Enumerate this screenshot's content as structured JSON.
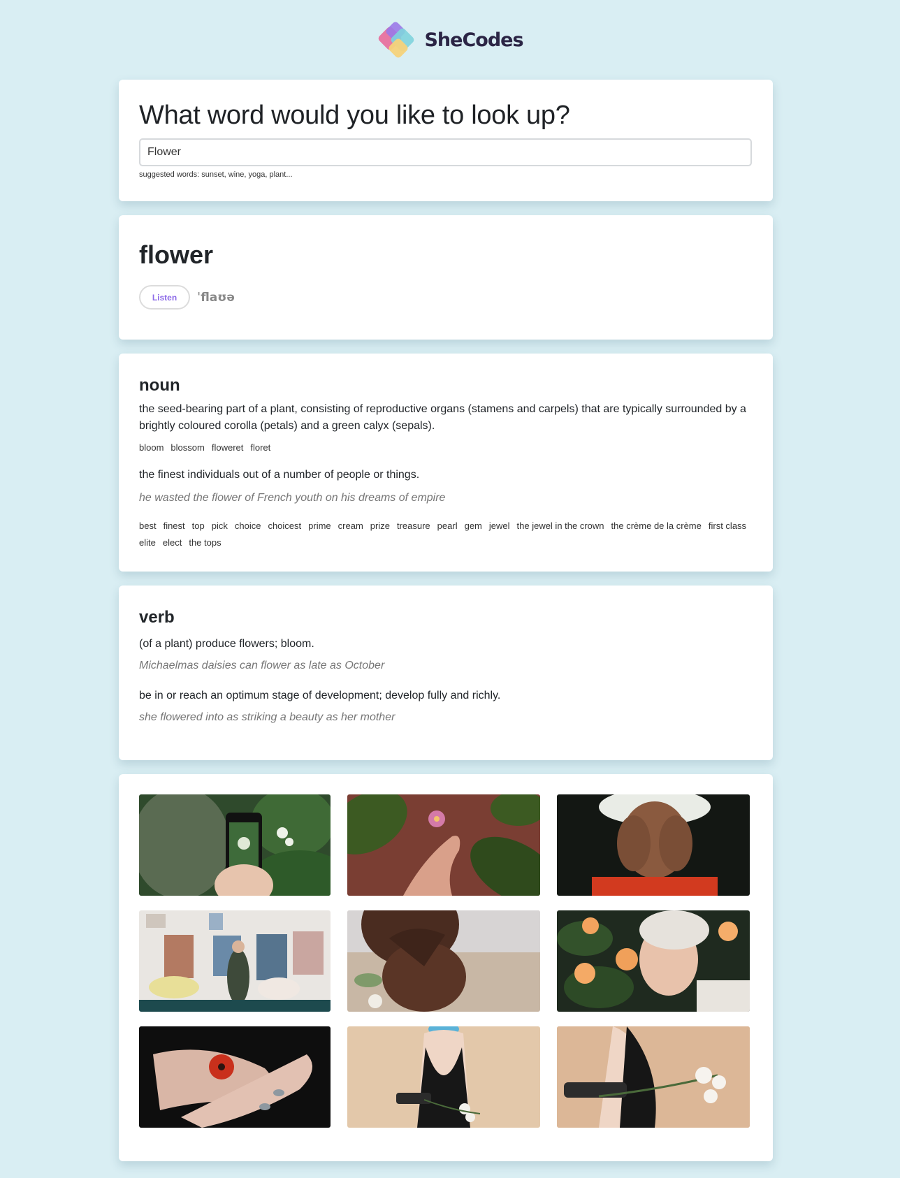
{
  "brand": {
    "name": "SheCodes",
    "logo_icon": "shecodes-logo-icon"
  },
  "search": {
    "heading": "What word would you like to look up?",
    "value": "Flower",
    "hint": "suggested words: sunset, wine, yoga, plant..."
  },
  "word": {
    "term": "flower",
    "listen_label": "Listen",
    "phonetic": "ˈflaʊə"
  },
  "meanings": [
    {
      "part_of_speech": "noun",
      "definitions": [
        {
          "text": "the seed-bearing part of a plant, consisting of reproductive organs (stamens and carpels) that are typically surrounded by a brightly coloured corolla (petals) and a green calyx (sepals).",
          "example": "",
          "synonyms": [
            "bloom",
            "blossom",
            "floweret",
            "floret"
          ]
        },
        {
          "text": "the finest individuals out of a number of people or things.",
          "example": "he wasted the flower of French youth on his dreams of empire",
          "synonyms": [
            "best",
            "finest",
            "top",
            "pick",
            "choice",
            "choicest",
            "prime",
            "cream",
            "prize",
            "treasure",
            "pearl",
            "gem",
            "jewel",
            "the jewel in the crown",
            "the crème de la crème",
            "first class",
            "elite",
            "elect",
            "the tops"
          ]
        }
      ]
    },
    {
      "part_of_speech": "verb",
      "definitions": [
        {
          "text": "(of a plant) produce flowers; bloom.",
          "example": "Michaelmas daisies can flower as late as October",
          "synonyms": []
        },
        {
          "text": "be in or reach an optimum stage of development; develop fully and richly.",
          "example": "she flowered into as striking a beauty as her mother",
          "synonyms": []
        }
      ]
    }
  ],
  "photos": [
    {
      "name": "photo-phone-flowers"
    },
    {
      "name": "photo-hand-pink-flower"
    },
    {
      "name": "photo-baby-breath-face"
    },
    {
      "name": "photo-florist-studio"
    },
    {
      "name": "photo-woman-flower-chin"
    },
    {
      "name": "photo-smiling-elder-woman"
    },
    {
      "name": "photo-hands-red-poppy"
    },
    {
      "name": "photo-back-black-dress"
    },
    {
      "name": "photo-back-white-flowers"
    }
  ],
  "colors": {
    "page_bg": "#d9eef3",
    "card_bg": "#ffffff",
    "accent": "#8d6be8",
    "muted": "#767676"
  }
}
